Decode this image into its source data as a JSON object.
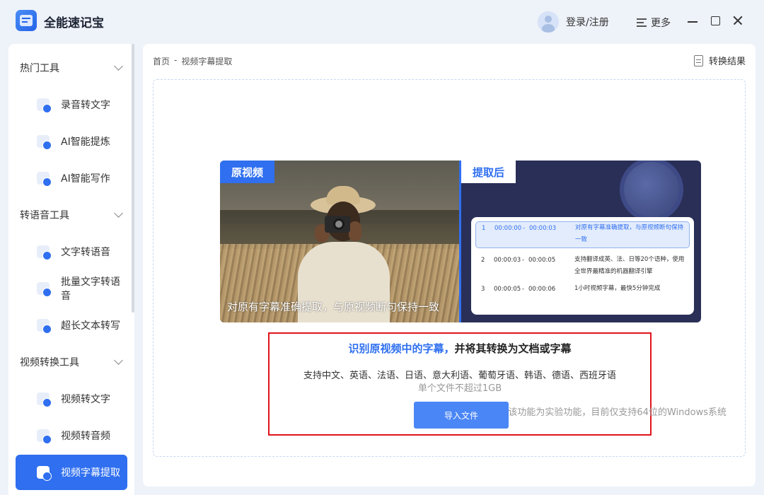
{
  "app": {
    "title": "全能速记宝"
  },
  "header": {
    "login_label": "登录/注册",
    "more_label": "更多"
  },
  "sidebar": {
    "groups": [
      {
        "title": "热门工具",
        "items": [
          {
            "label": "录音转文字"
          },
          {
            "label": "AI智能提炼"
          },
          {
            "label": "AI智能写作"
          }
        ]
      },
      {
        "title": "转语音工具",
        "items": [
          {
            "label": "文字转语音"
          },
          {
            "label": "批量文字转语音"
          },
          {
            "label": "超长文本转写"
          }
        ]
      },
      {
        "title": "视频转换工具",
        "items": [
          {
            "label": "视频转文字"
          },
          {
            "label": "视频转音频"
          },
          {
            "label": "视频字幕提取"
          }
        ]
      }
    ],
    "active_item": "视频字幕提取"
  },
  "main": {
    "breadcrumb": {
      "home": "首页",
      "separator": "-",
      "current": "视频字幕提取"
    },
    "result_link": "转换结果",
    "preview": {
      "left_tag": "原视频",
      "right_tag": "提取后",
      "caption": "对原有字幕准确提取，与原视频断句保持一致",
      "subtitles": [
        {
          "index": "1",
          "start": "00:00:00",
          "dash": "-",
          "end": "00:00:03",
          "text": "对原有字幕准确提取，与原视频断句保持一致"
        },
        {
          "index": "2",
          "start": "00:00:03",
          "dash": "-",
          "end": "00:00:05",
          "text": "支持翻译成英、法、日等20个语种，使用全世界最精准的机器翻译引擎"
        },
        {
          "index": "3",
          "start": "00:00:05",
          "dash": "-",
          "end": "00:00:06",
          "text": "1小时视频字幕，最快5分钟完成"
        }
      ]
    },
    "info": {
      "headline_blue": "识别原视频中的字幕，",
      "headline_black": "并将其转换为文档或字幕",
      "languages": "支持中文、英语、法语、日语、意大利语、葡萄牙语、韩语、德语、西班牙语",
      "limit": "单个文件不超过1GB",
      "import_button": "导入文件"
    },
    "footer_note": "该功能为实验功能，目前仅支持64位的Windows系统"
  },
  "colors": {
    "accent": "#2f6ff0",
    "highlight_border": "#e0141a",
    "background": "#eef2f9"
  }
}
